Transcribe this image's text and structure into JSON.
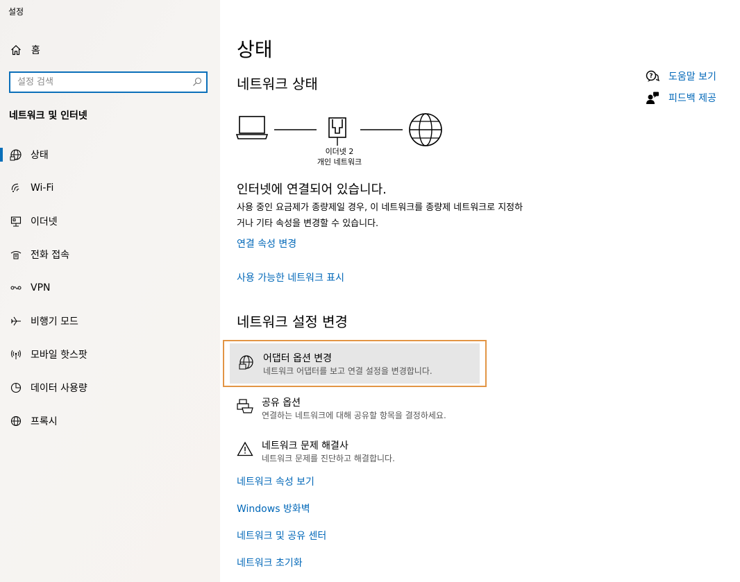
{
  "app": {
    "title": "설정"
  },
  "sidebar": {
    "home_label": "홈",
    "search_placeholder": "설정 검색",
    "section_title": "네트워크 및 인터넷",
    "items": [
      {
        "label": "상태",
        "icon": "globe-status-icon",
        "active": true
      },
      {
        "label": "Wi-Fi",
        "icon": "wifi-icon"
      },
      {
        "label": "이더넷",
        "icon": "ethernet-icon"
      },
      {
        "label": "전화 접속",
        "icon": "dialup-icon"
      },
      {
        "label": "VPN",
        "icon": "vpn-icon"
      },
      {
        "label": "비행기 모드",
        "icon": "airplane-icon"
      },
      {
        "label": "모바일 핫스팟",
        "icon": "hotspot-icon"
      },
      {
        "label": "데이터 사용량",
        "icon": "data-usage-icon"
      },
      {
        "label": "프록시",
        "icon": "proxy-globe-icon"
      }
    ]
  },
  "main": {
    "page_title": "상태",
    "network_status_title": "네트워크 상태",
    "adapter_name": "이더넷 2",
    "network_type": "개인 네트워크",
    "connected_text": "인터넷에 연결되어 있습니다.",
    "description": "사용 중인 요금제가 종량제일 경우, 이 네트워크를 종량제 네트워크로 지정하거나 기타 속성을 변경할 수 있습니다.",
    "link_change_props": "연결 속성 변경",
    "link_show_networks": "사용 가능한 네트워크 표시",
    "change_settings_title": "네트워크 설정 변경",
    "options": [
      {
        "title": "어댑터 옵션 변경",
        "subtitle": "네트워크 어댑터를 보고 연결 설정을 변경합니다.",
        "icon": "adapter-globe-icon"
      },
      {
        "title": "공유 옵션",
        "subtitle": "연결하는 네트워크에 대해 공유할 항목을 결정하세요.",
        "icon": "sharing-icon"
      },
      {
        "title": "네트워크 문제 해결사",
        "subtitle": "네트워크 문제를 진단하고 해결합니다.",
        "icon": "warning-icon"
      }
    ],
    "bottom_links": [
      "네트워크 속성 보기",
      "Windows 방화벽",
      "네트워크 및 공유 센터",
      "네트워크 초기화"
    ],
    "help_link": "도움말 보기",
    "feedback_link": "피드백 제공"
  },
  "colors": {
    "accent": "#0067b8",
    "focus_border": "#e29545"
  }
}
